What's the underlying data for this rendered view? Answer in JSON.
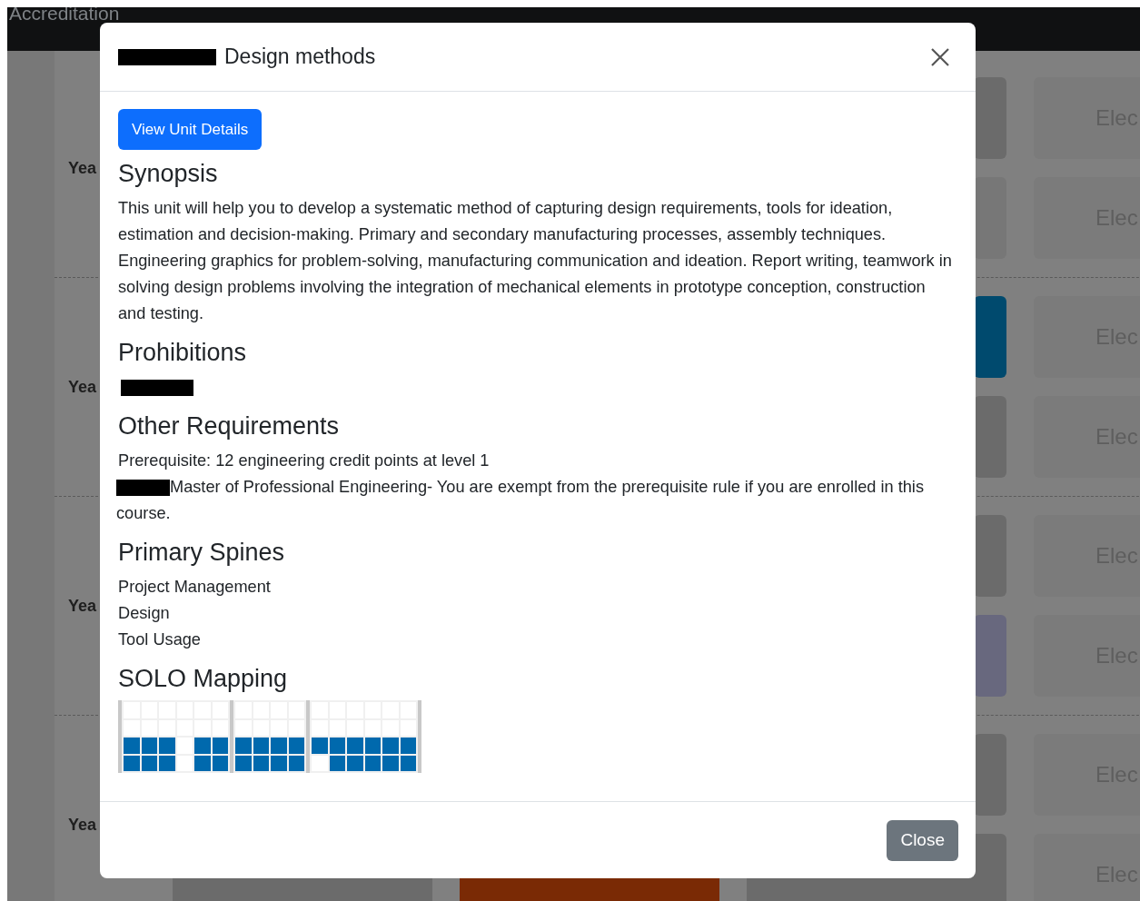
{
  "navbar": {
    "brand": "Accreditation"
  },
  "background": {
    "years": [
      {
        "label": "Yea",
        "rows": [
          {
            "cards": [
              {
                "kind": "unit",
                "color": "#6b6b6b"
              },
              {
                "kind": "elective",
                "label": "Elec"
              }
            ]
          },
          {
            "cards": [
              {
                "kind": "unit",
                "color": "#777777"
              },
              {
                "kind": "elective",
                "label": "Elec"
              }
            ]
          }
        ]
      },
      {
        "label": "Yea",
        "rows": [
          {
            "cards": [
              {
                "kind": "unit",
                "color": "#004a6e"
              },
              {
                "kind": "elective",
                "label": "Elec"
              }
            ]
          },
          {
            "cards": [
              {
                "kind": "unit",
                "color": "#6b6b6b"
              },
              {
                "kind": "elective",
                "label": "Elec"
              }
            ]
          }
        ]
      },
      {
        "label": "Yea",
        "rows": [
          {
            "cards": [
              {
                "kind": "unit",
                "color": "#6b6b6b"
              },
              {
                "kind": "elective",
                "label": "Elec"
              }
            ]
          },
          {
            "cards": [
              {
                "kind": "unit",
                "color": "#68687e"
              },
              {
                "kind": "elective",
                "label": "Elec"
              }
            ]
          }
        ]
      },
      {
        "label": "Yea",
        "rows": [
          {
            "cards": [
              {
                "kind": "unit",
                "color": "#6b6b6b"
              },
              {
                "kind": "elective",
                "label": "Elec"
              }
            ]
          },
          {
            "cards": [
              {
                "kind": "unit",
                "color": "#6b6b6b"
              },
              {
                "kind": "unit",
                "color": "#7a2a05"
              },
              {
                "kind": "unit",
                "color": "#6b6b6b"
              },
              {
                "kind": "elective",
                "label": "Elec"
              }
            ]
          }
        ]
      }
    ]
  },
  "modal": {
    "title": {
      "redacted": true,
      "text": "Design methods"
    },
    "details_button": "View Unit Details",
    "sections": [
      {
        "heading": "Synopsis",
        "lines": [
          {
            "redacted": false,
            "text": "This unit will help you to develop a systematic method of capturing design requirements, tools for ideation, estimation and decision-making. Primary and secondary manufacturing processes, assembly techniques. Engineering graphics for problem-solving, manufacturing communication and ideation. Report writing, teamwork in solving design problems involving the integration of mechanical elements in prototype conception, construction and testing."
          }
        ]
      },
      {
        "heading": "Prohibitions",
        "lines": [
          {
            "redacted": true
          }
        ]
      },
      {
        "heading": "Other Requirements",
        "lines": [
          {
            "redacted": false,
            "text": "Prerequisite: 12 engineering credit points at level 1"
          },
          {
            "redacted": true,
            "text": "Master of Professional Engineering- You are exempt from the prerequisite rule if you are enrolled in this course."
          }
        ]
      },
      {
        "heading": "Primary Spines",
        "lines": [
          {
            "redacted": false,
            "text": "Project Management"
          },
          {
            "redacted": false,
            "text": "Design"
          },
          {
            "redacted": false,
            "text": "Tool Usage"
          }
        ]
      }
    ],
    "solo": {
      "heading": "SOLO Mapping",
      "groups": [
        {
          "rows": [
            [
              false,
              false,
              false,
              false,
              false,
              false
            ],
            [
              false,
              false,
              false,
              false,
              false,
              false
            ],
            [
              true,
              true,
              true,
              false,
              true,
              true
            ],
            [
              true,
              true,
              true,
              false,
              true,
              true
            ]
          ]
        },
        {
          "rows": [
            [
              false,
              false,
              false,
              false
            ],
            [
              false,
              false,
              false,
              false
            ],
            [
              true,
              true,
              true,
              true
            ],
            [
              true,
              true,
              true,
              true
            ]
          ]
        },
        {
          "rows": [
            [
              false,
              false,
              false,
              false,
              false,
              false
            ],
            [
              false,
              false,
              false,
              false,
              false,
              false
            ],
            [
              true,
              true,
              true,
              true,
              true,
              true
            ],
            [
              false,
              true,
              true,
              true,
              true,
              true
            ]
          ]
        }
      ]
    },
    "close_button": "Close"
  }
}
